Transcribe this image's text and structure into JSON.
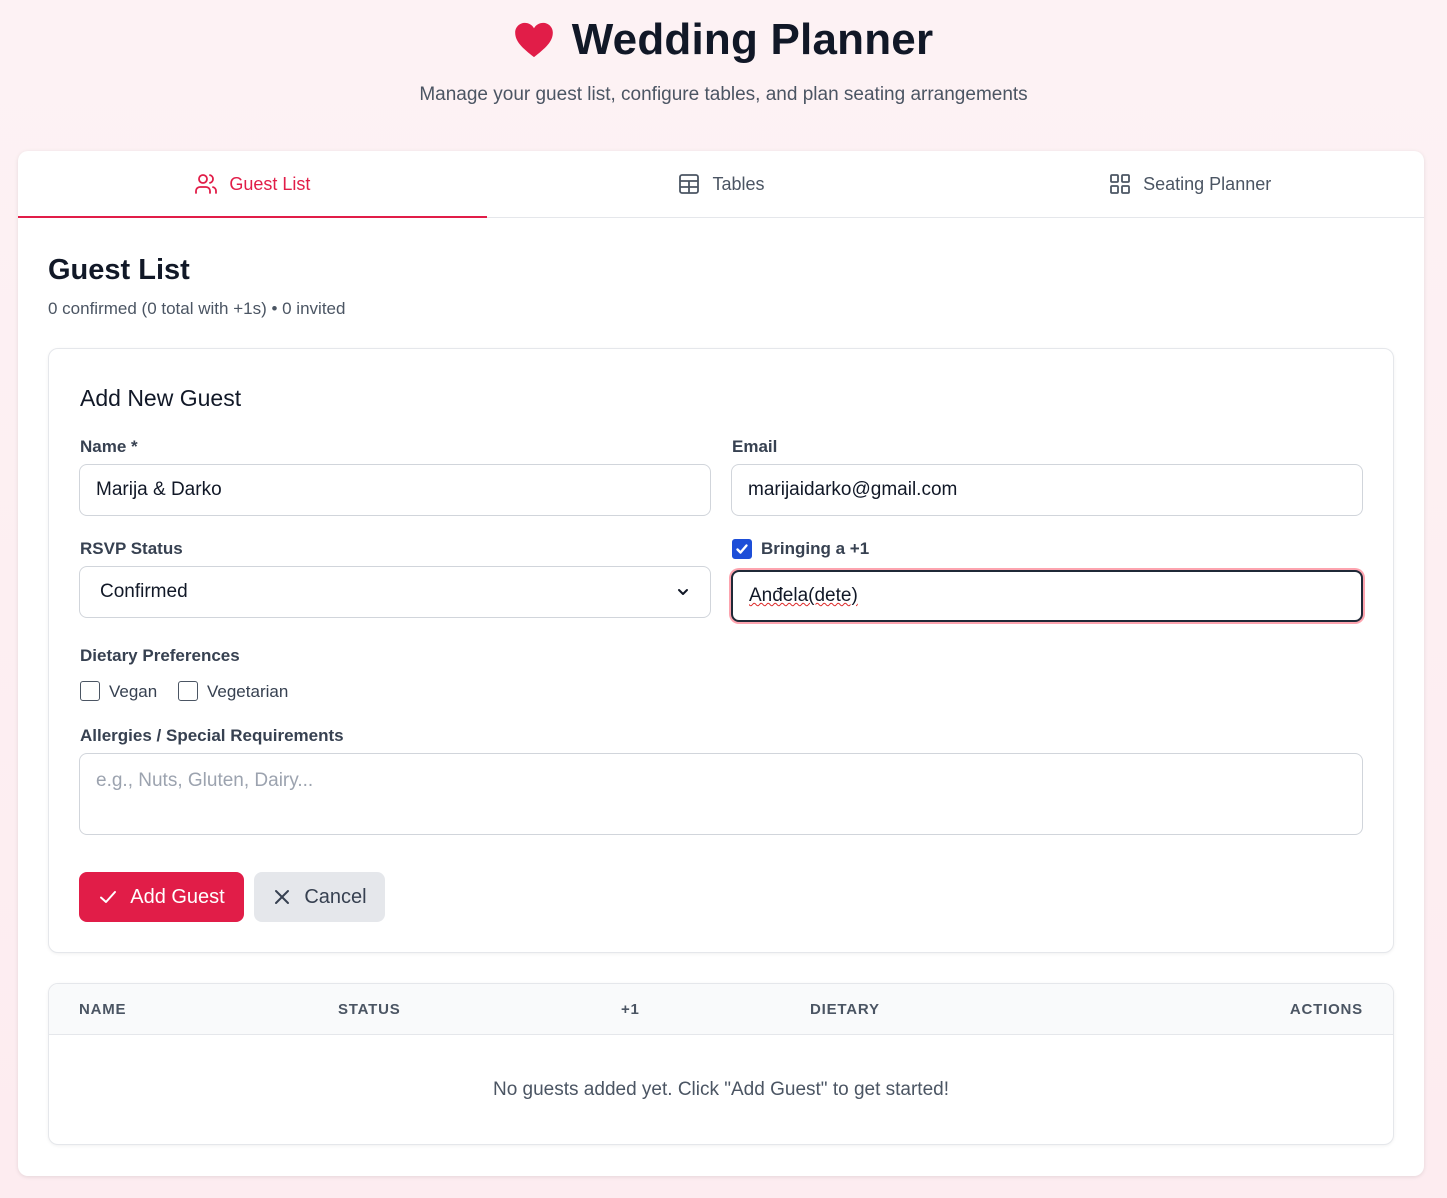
{
  "app": {
    "title": "Wedding Planner",
    "subtitle": "Manage your guest list, configure tables, and plan seating arrangements",
    "heart_icon": "heart-icon",
    "accent_color": "#e11d48"
  },
  "tabs": [
    {
      "label": "Guest List",
      "icon": "users-icon",
      "active": true
    },
    {
      "label": "Tables",
      "icon": "table-icon",
      "active": false
    },
    {
      "label": "Seating Planner",
      "icon": "grid-icon",
      "active": false
    }
  ],
  "guest_list": {
    "title": "Guest List",
    "stats": "0 confirmed (0 total with +1s) • 0 invited"
  },
  "form": {
    "title": "Add New Guest",
    "name_label": "Name *",
    "name_value": "Marija & Darko",
    "email_label": "Email",
    "email_value": "marijaidarko@gmail.com",
    "rsvp_label": "RSVP Status",
    "rsvp_value": "Confirmed",
    "plus_one_label": "Bringing a +1",
    "plus_one_checked": true,
    "plus_one_name": "Anđela(dete)",
    "dietary_label": "Dietary Preferences",
    "dietary_options": [
      {
        "label": "Vegan",
        "checked": false
      },
      {
        "label": "Vegetarian",
        "checked": false
      }
    ],
    "allergies_label": "Allergies / Special Requirements",
    "allergies_placeholder": "e.g., Nuts, Gluten, Dairy...",
    "add_button": "Add Guest",
    "cancel_button": "Cancel"
  },
  "table": {
    "columns": [
      "NAME",
      "STATUS",
      "+1",
      "DIETARY",
      "ACTIONS"
    ],
    "empty_message": "No guests added yet. Click \"Add Guest\" to get started!"
  }
}
